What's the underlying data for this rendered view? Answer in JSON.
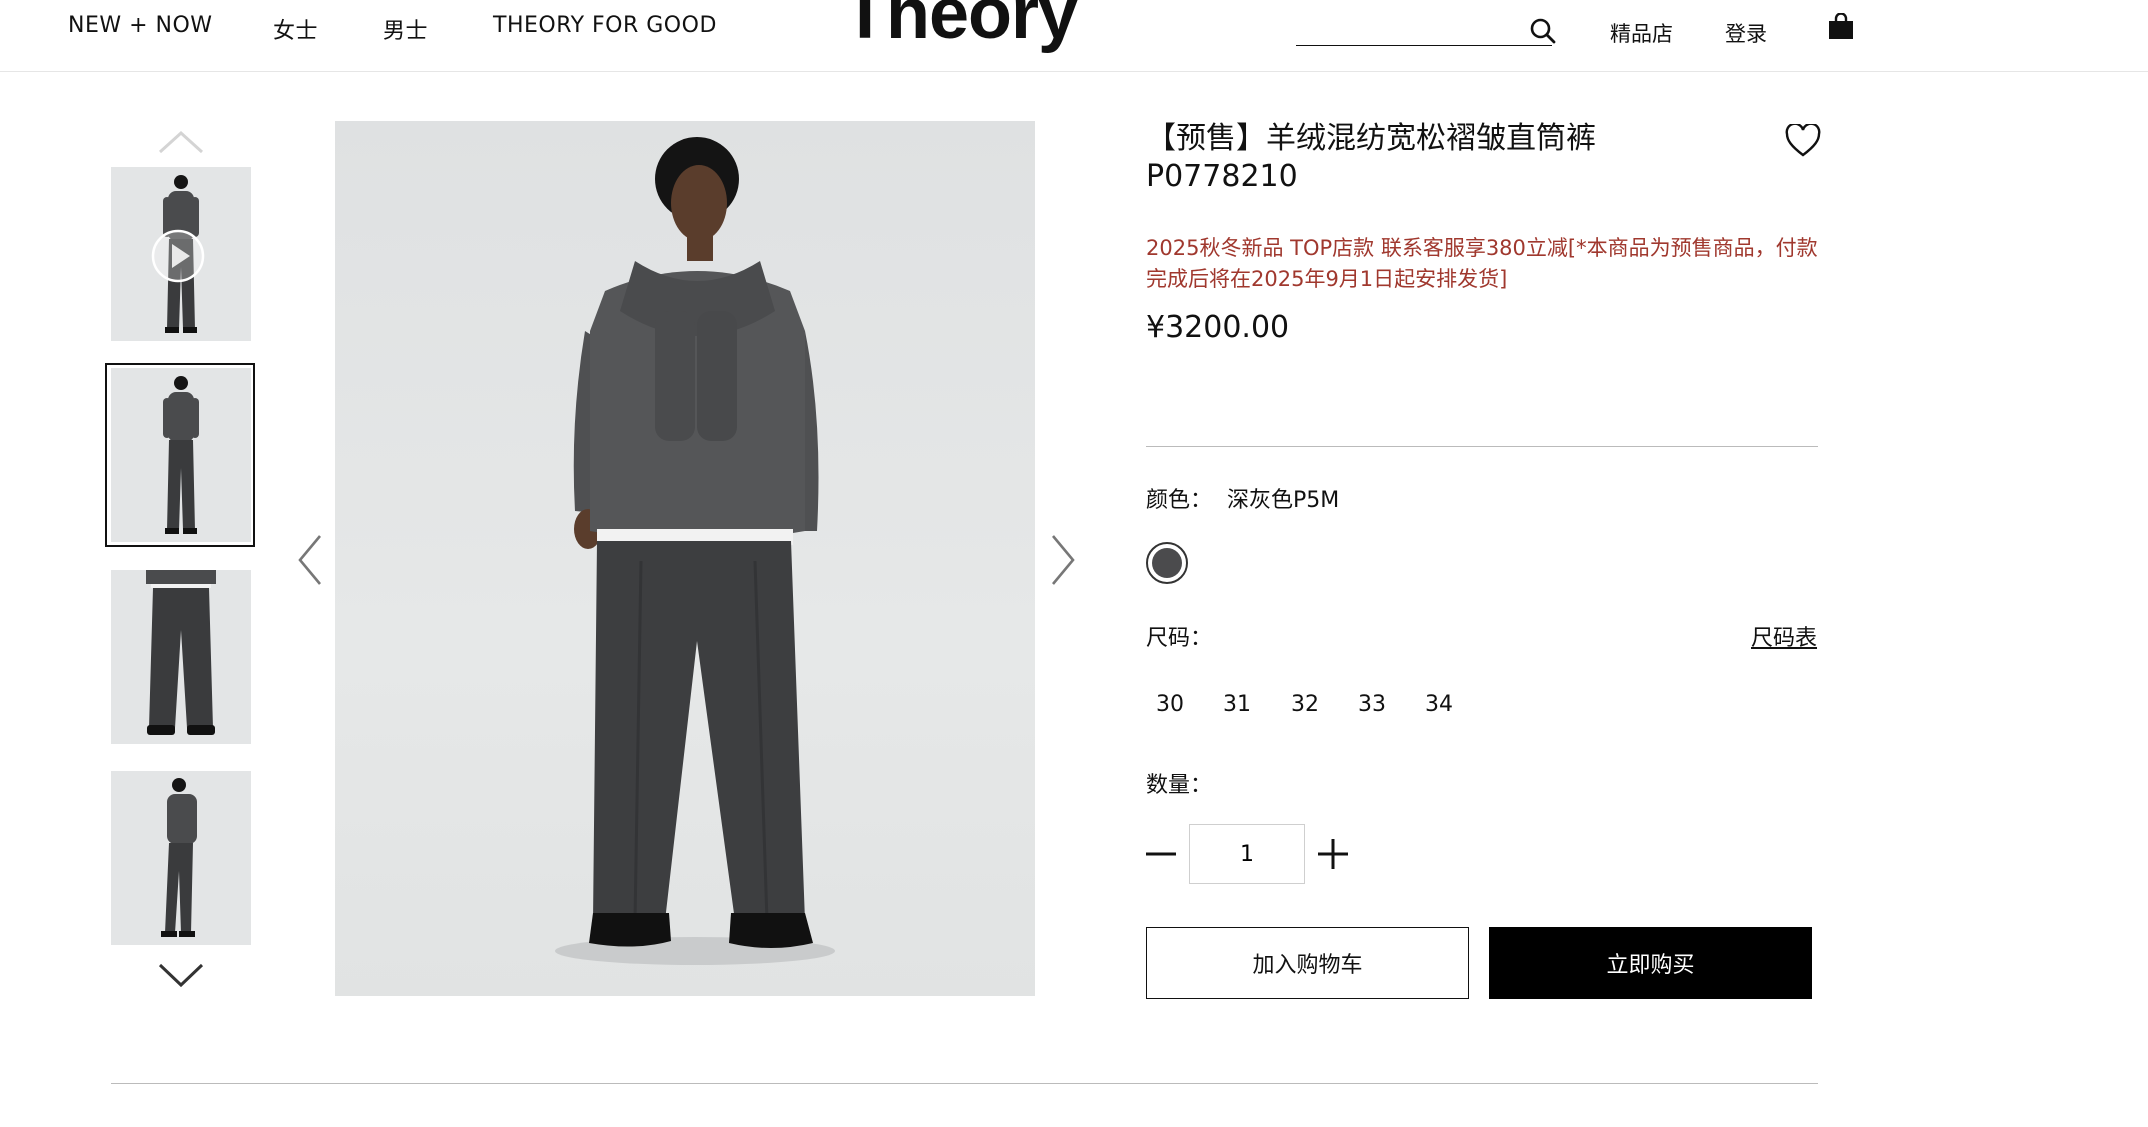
{
  "header": {
    "nav": [
      "NEW + NOW",
      "女士",
      "男士",
      "THEORY FOR GOOD"
    ],
    "logo": "Theory",
    "search_placeholder": "",
    "stores": "精品店",
    "login": "登录"
  },
  "product": {
    "title": "【预售】羊绒混纺宽松褶皱直筒裤",
    "sku": "P0778210",
    "promo": "2025秋冬新品 TOP店款 联系客服享380立减[*本商品为预售商品，付款完成后将在2025年9月1日起安排发货]",
    "price": "¥3200.00",
    "color_label": "颜色：",
    "color_value": "深灰色P5M",
    "size_label": "尺码：",
    "size_chart": "尺码表",
    "sizes": [
      "30",
      "31",
      "32",
      "33",
      "34"
    ],
    "qty_label": "数量：",
    "qty_value": "1",
    "add_to_cart": "加入购物车",
    "buy_now": "立即购买"
  },
  "colors": {
    "promo": "#a0382e",
    "swatch": "#4b4b4d",
    "accent": "#000000"
  }
}
